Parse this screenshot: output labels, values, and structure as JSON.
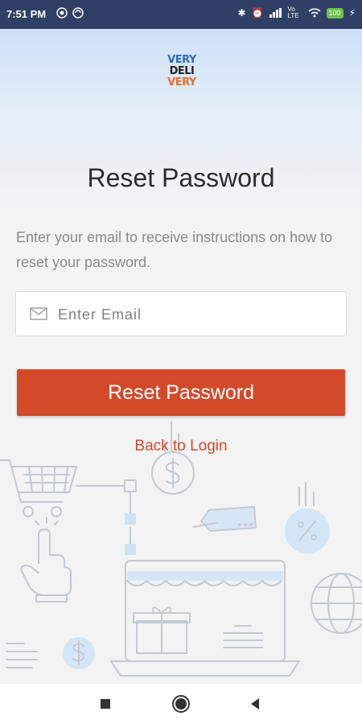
{
  "status_bar": {
    "time": "7:51 PM",
    "network_label": "Vo LTE",
    "battery": "100"
  },
  "logo": {
    "line1": "VERY",
    "line2": "DELI",
    "line3": "VERY"
  },
  "page": {
    "title": "Reset Password",
    "description": "Enter your email to receive instructions on how to reset your password."
  },
  "email": {
    "placeholder": "Enter Email",
    "value": ""
  },
  "reset_button": {
    "label": "Reset Password"
  },
  "back_link": {
    "label": "Back to Login"
  },
  "colors": {
    "accent": "#d34a2b",
    "status_bar": "#2f3f66",
    "illustration_line": "#c4c9d1",
    "illustration_fill": "#cfe2f4"
  }
}
